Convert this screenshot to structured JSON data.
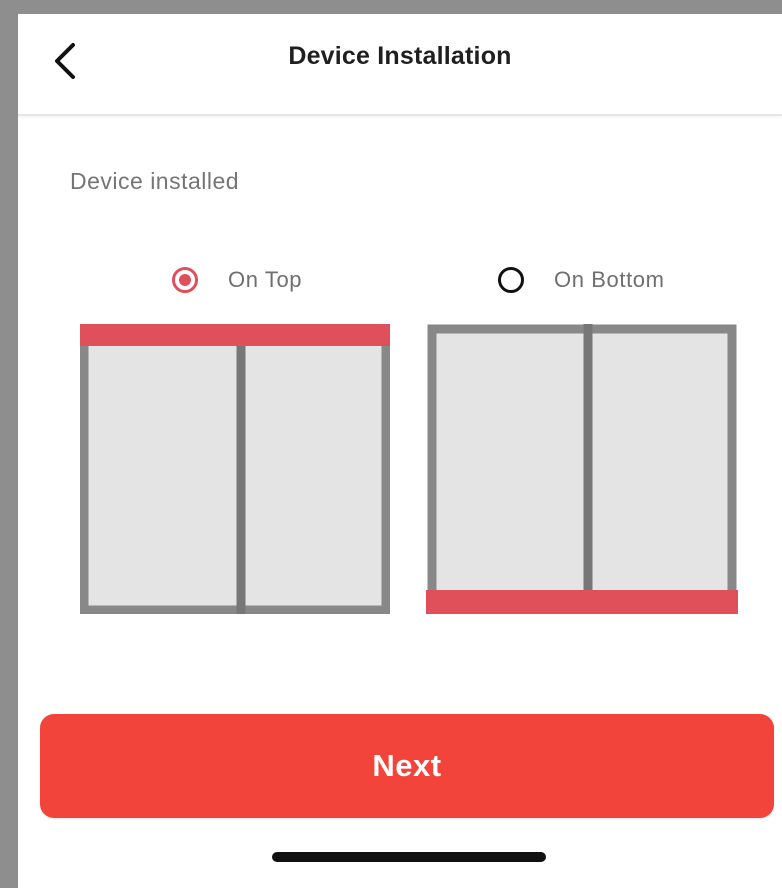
{
  "header": {
    "title": "Device Installation",
    "back_icon": "chevron-left-icon"
  },
  "section": {
    "label": "Device installed"
  },
  "options": [
    {
      "id": "on-top",
      "label": "On Top",
      "selected": true
    },
    {
      "id": "on-bottom",
      "label": "On Bottom",
      "selected": false
    }
  ],
  "colors": {
    "accent": "#f2443a",
    "rail": "#e0505a",
    "frame": "#888888",
    "pane": "#e4e4e4"
  },
  "footer": {
    "next_label": "Next"
  }
}
